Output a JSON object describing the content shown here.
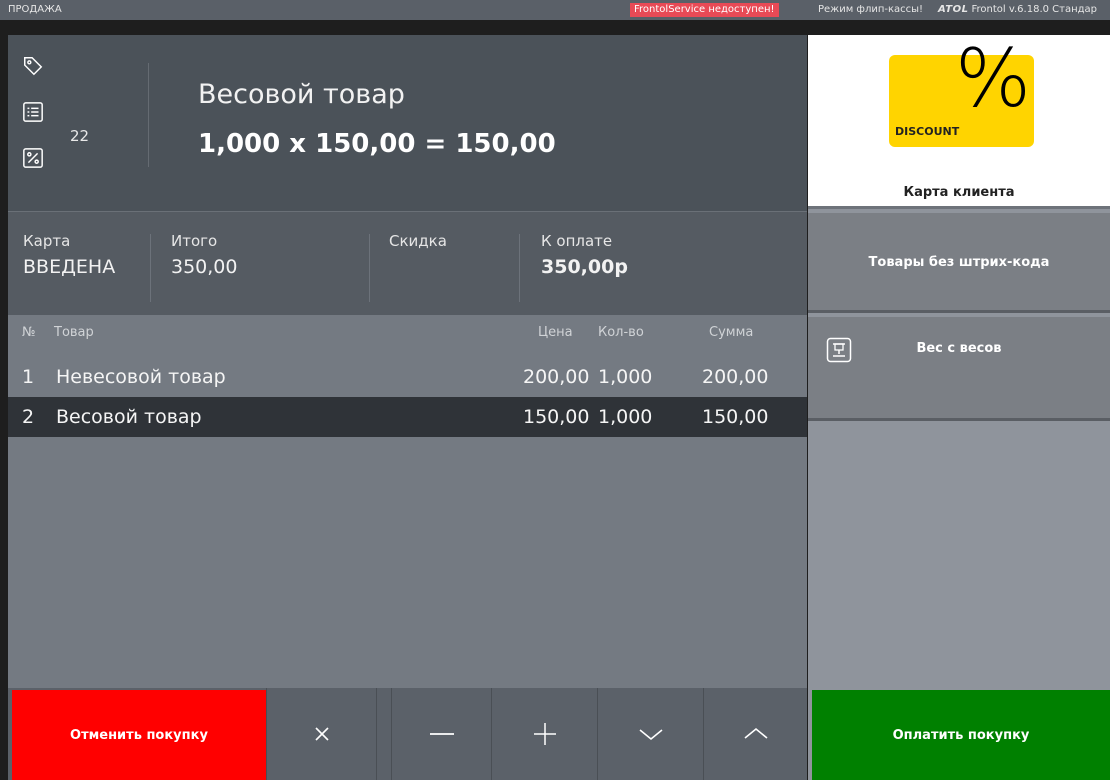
{
  "titlebar": {
    "mode": "ПРОДАЖА",
    "service_status": "FrontolService недоступен!",
    "flip_mode": "Режим флип-кассы!",
    "brand": "ATOL",
    "version": "Frontol v.6.18.0 Стандар"
  },
  "item": {
    "name": "Весовой товар",
    "calc": "1,000 x 150,00 = 150,00",
    "count": "22",
    "icons": [
      "tag-icon",
      "list-icon",
      "percent-icon"
    ]
  },
  "totals": {
    "card_label": "Карта",
    "card_value": "ВВЕДЕНА",
    "total_label": "Итого",
    "total_value": "350,00",
    "discount_label": "Скидка",
    "discount_value": "",
    "topay_label": "К оплате",
    "topay_value": "350,00р"
  },
  "table": {
    "columns": {
      "num": "№",
      "product": "Товар",
      "price": "Цена",
      "qty": "Кол-во",
      "sum": "Сумма"
    },
    "rows": [
      {
        "num": "1",
        "product": "Невесовой товар",
        "price": "200,00",
        "qty": "1,000",
        "sum": "200,00"
      },
      {
        "num": "2",
        "product": "Весовой товар",
        "price": "150,00",
        "qty": "1,000",
        "sum": "150,00",
        "selected": true
      }
    ]
  },
  "actions": {
    "cancel": "Отменить покупку",
    "nav_icons": [
      "close-icon",
      "minus-icon",
      "plus-icon",
      "chevron-down-icon",
      "chevron-up-icon"
    ],
    "pay": "Оплатить покупку"
  },
  "right_panel": {
    "discount_card_text": "DISCOUNT",
    "discount_symbol": "%",
    "card_label": "Карта клиента",
    "no_barcode_label": "Товары без штрих-кода",
    "scale_label": "Вес с весов"
  },
  "colors": {
    "cancel": "#ff0000",
    "pay": "#008000",
    "service_alert": "#e84a56",
    "discount_card": "#ffd400"
  }
}
